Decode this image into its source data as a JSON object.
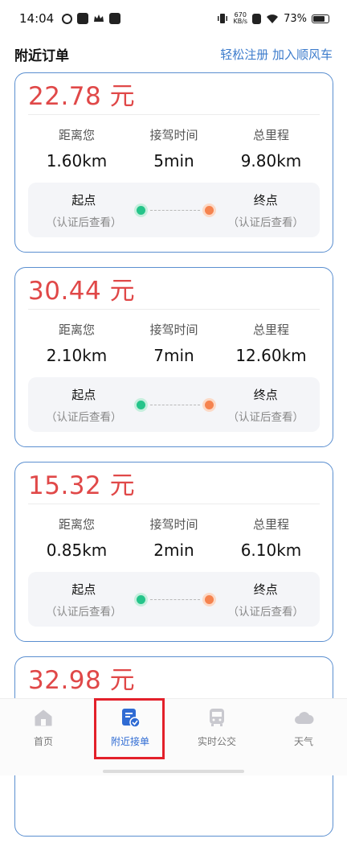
{
  "status_bar": {
    "time": "14:04",
    "net_speed_value": "670",
    "net_speed_unit": "KB/s",
    "battery": "73%"
  },
  "header": {
    "title": "附近订单",
    "register_link": "轻松注册 加入顺风车"
  },
  "labels": {
    "distance": "距离您",
    "pickup_time": "接驾时间",
    "total_mileage": "总里程",
    "start": "起点",
    "end": "终点",
    "hint": "（认证后查看）"
  },
  "orders": [
    {
      "price": "22.78 元",
      "distance": "1.60km",
      "pickup_time": "5min",
      "total_mileage": "9.80km"
    },
    {
      "price": "30.44 元",
      "distance": "2.10km",
      "pickup_time": "7min",
      "total_mileage": "12.60km"
    },
    {
      "price": "15.32 元",
      "distance": "0.85km",
      "pickup_time": "2min",
      "total_mileage": "6.10km"
    },
    {
      "price": "32.98 元"
    }
  ],
  "tabs": [
    {
      "label": "首页",
      "icon": "home-icon"
    },
    {
      "label": "附近接单",
      "icon": "order-icon",
      "active": true
    },
    {
      "label": "实时公交",
      "icon": "bus-icon"
    },
    {
      "label": "天气",
      "icon": "cloud-icon"
    }
  ],
  "colors": {
    "accent": "#2f6bd3",
    "price": "#e04848",
    "card_border": "#5b8fd0",
    "start_dot": "#25c48a",
    "end_dot": "#f5834f",
    "highlight": "#e3202a"
  }
}
